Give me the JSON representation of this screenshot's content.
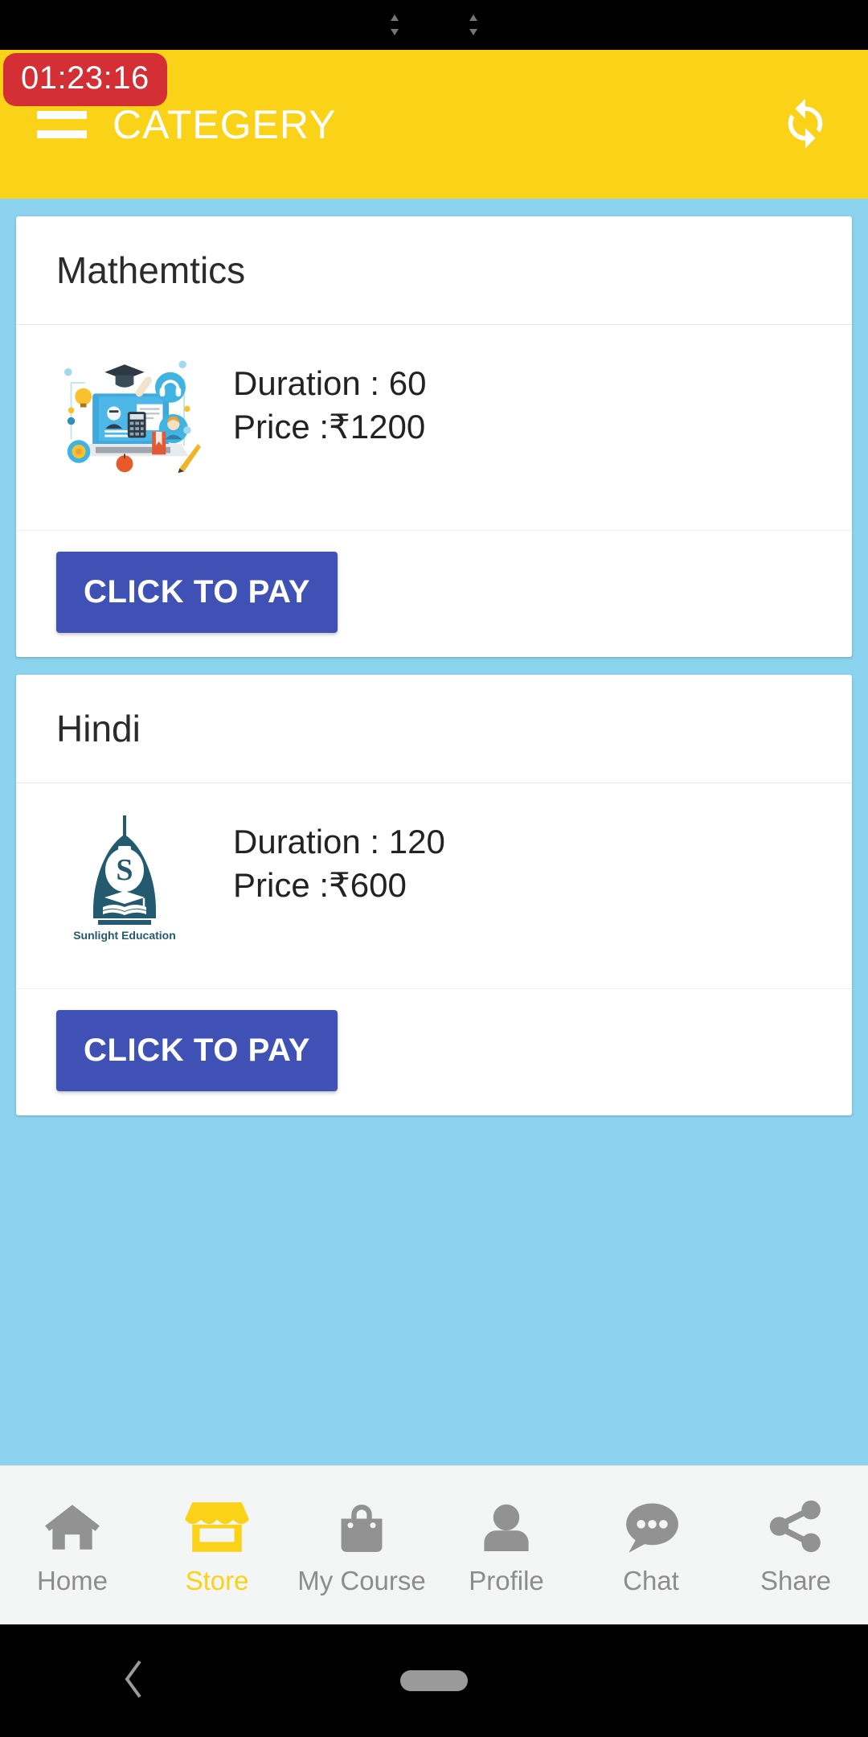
{
  "status_bar": {
    "icons": [
      "updown-arrows-icon",
      "updown-arrows-icon"
    ]
  },
  "app_bar": {
    "title": "CATEGERY",
    "menu_icon": "hamburger-menu-icon",
    "refresh_icon": "refresh-icon",
    "background_color": "#fad218",
    "title_color": "#ffffff"
  },
  "timer": {
    "value": "01:23:16",
    "background_color": "#d32f34",
    "text_color": "#ffffff"
  },
  "content": {
    "background_color": "#8bd3ef",
    "cards": [
      {
        "title": "Mathemtics",
        "duration": "Duration : 60",
        "price": "Price :₹1200",
        "thumbnail": "elearning-illustration-icon",
        "pay_label": "CLICK TO PAY"
      },
      {
        "title": "Hindi",
        "duration": "Duration : 120",
        "price": "Price :₹600",
        "thumbnail": "sunlight-education-logo-icon",
        "logo_caption": "Sunlight Education",
        "pay_label": "CLICK TO PAY"
      }
    ],
    "pay_button_color": "#3f51b5"
  },
  "bottom_nav": {
    "active_color": "#fad218",
    "inactive_color": "#8d8d8d",
    "items": [
      {
        "label": "Home",
        "icon": "home-icon",
        "active": false
      },
      {
        "label": "Store",
        "icon": "store-icon",
        "active": true
      },
      {
        "label": "My Course",
        "icon": "shopping-bag-icon",
        "active": false
      },
      {
        "label": "Profile",
        "icon": "person-icon",
        "active": false
      },
      {
        "label": "Chat",
        "icon": "chat-bubble-icon",
        "active": false
      },
      {
        "label": "Share",
        "icon": "share-icon",
        "active": false
      }
    ]
  },
  "android_nav": {
    "back_icon": "back-chevron-icon",
    "home_icon": "home-pill-icon"
  }
}
